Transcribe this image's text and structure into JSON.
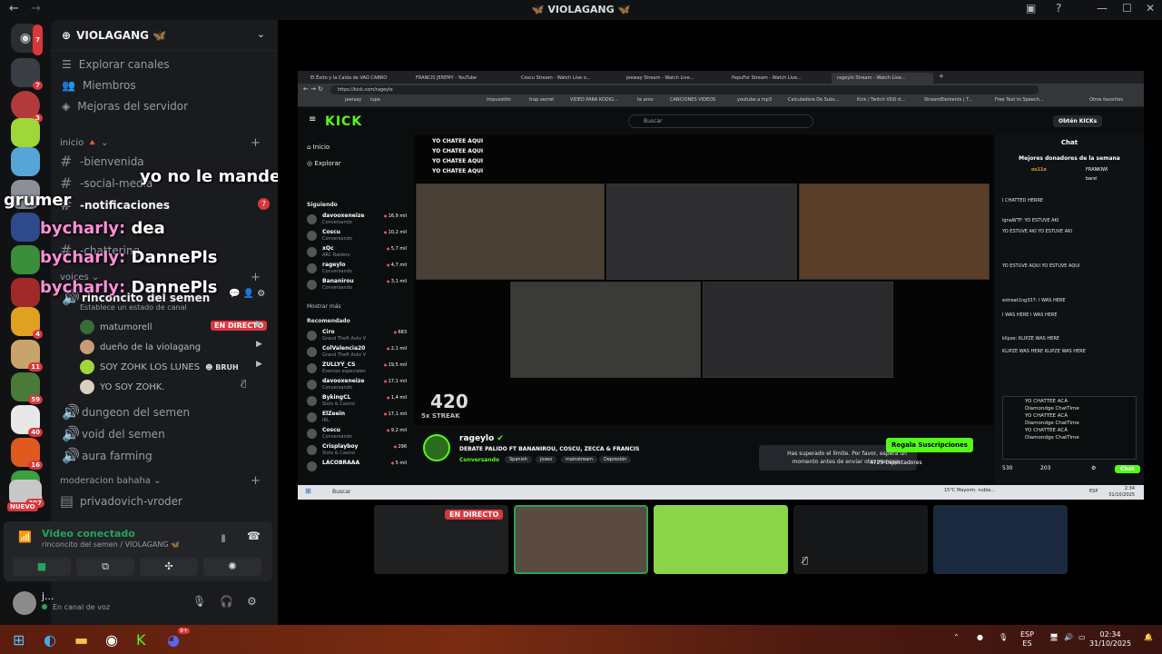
{
  "window": {
    "title": "VIOLAGANG",
    "title_emoji": "🦋"
  },
  "server_rail": {
    "badges": [
      "7",
      "7",
      "3",
      "4",
      "11",
      "59",
      "40",
      "16",
      "114",
      "397"
    ],
    "new_label": "NUEVO"
  },
  "server": {
    "name": "VIOLAGANG",
    "emoji": "🦋",
    "nav": [
      "Explorar canales",
      "Miembros",
      "Mejoras del servidor"
    ]
  },
  "categories": {
    "inicio": "inicio",
    "voices": "voices",
    "moderacion": "moderacion bahaha"
  },
  "channels": {
    "bienvenida": "-bienvenida",
    "social": "-social-media",
    "notificaciones": "-notificaciones",
    "notificaciones_badge": "7",
    "chattering": "-chattering",
    "rinconcito": "rinconcito del semen",
    "status_hint": "Establece un estado de canal",
    "dungeon": "dungeon del semen",
    "void": "void del semen",
    "aura": "aura farming",
    "privadovich": "privadovich-vroder"
  },
  "voice_users": [
    {
      "name": "matumorell",
      "live": "EN DIRECTO"
    },
    {
      "name": "dueño de la violagang"
    },
    {
      "name": "SOY ZOHK LOS LUNES",
      "tag": "BRUH"
    },
    {
      "name": "YO SOY ZOHK."
    }
  ],
  "overlay_chat": [
    {
      "text": "yo no le mande nada"
    },
    {
      "text": "grumer"
    },
    {
      "user": "bycharly:",
      "text": "dea"
    },
    {
      "user": "bycharly:",
      "text": "DannePls"
    },
    {
      "user": "bycharly:",
      "text": "DannePls"
    }
  ],
  "voice_panel": {
    "status": "Video conectado",
    "location": "rinconcito del semen / VIOLAGANG"
  },
  "user": {
    "name": "j...",
    "status": "En canal de voz"
  },
  "browser": {
    "tabs": [
      "El Éxito y la Caída de VAO CABRO",
      "FRANCIS JEREMY - YouTube",
      "Coscu Stream - Watch Live o...",
      "jeeway Stream - Watch Live...",
      "PepuFor Stream - Watch Live...",
      "rageylo Stream - Watch Live..."
    ],
    "url": "https://kick.com/rageylo",
    "bookmarks": [
      "jeersay",
      "lupe",
      "impuestito",
      "trap secret",
      "VIDEO PARA KODIG...",
      "te amo",
      "CANCIONES VIDEOS",
      "youtube a mp3",
      "Calculadora De Subs...",
      "Kick / Twitch VOD d...",
      "StreamElements | T...",
      "Free Text to Speech...",
      "Otros favoritos"
    ]
  },
  "kick": {
    "logo": "KICK",
    "search_placeholder": "Buscar",
    "get_kicks": "Obtén KICKs",
    "nav": [
      "Inicio",
      "Explorar"
    ],
    "following_label": "Siguiendo",
    "following": [
      {
        "name": "davooxeneize",
        "game": "Conversando",
        "viewers": "16,9 mil"
      },
      {
        "name": "Coscu",
        "game": "Conversando",
        "viewers": "10,2 mil"
      },
      {
        "name": "xQc",
        "game": "ARC Raiders",
        "viewers": "5,7 mil"
      },
      {
        "name": "rageylo",
        "game": "Conversando",
        "viewers": "4,7 mil"
      },
      {
        "name": "Bananirou",
        "game": "Conversando",
        "viewers": "3,1 mil"
      }
    ],
    "show_more": "Mostrar más",
    "recommended_label": "Recomendado",
    "recommended": [
      {
        "name": "Ciro",
        "game": "Grand Theft Auto V",
        "viewers": "683"
      },
      {
        "name": "ColValencia20",
        "game": "Grand Theft Auto V",
        "viewers": "2,1 mil"
      },
      {
        "name": "ZULLYY_CS",
        "game": "Eventos especiales",
        "viewers": "19,5 mil"
      },
      {
        "name": "davooxeneize",
        "game": "Conversando",
        "viewers": "17,1 mil"
      },
      {
        "name": "BykingCL",
        "game": "Slots & Casino",
        "viewers": "1,4 mil"
      },
      {
        "name": "ElZeein",
        "game": "IRL",
        "viewers": "17,1 mil"
      },
      {
        "name": "Coscu",
        "game": "Conversando",
        "viewers": "9,2 mil"
      },
      {
        "name": "Crisplayboy",
        "game": "Slots & Casino",
        "viewers": "296"
      },
      {
        "name": "LACOBRAAA",
        "game": "",
        "viewers": "5 mil"
      }
    ],
    "channel": "rageylo",
    "stream_title": "DEBATE PALIDO FT BANANIROU, COSCU, ZECCA & FRANCIS",
    "category": "Conversando",
    "tags": [
      "Spanish",
      "joseo",
      "mainstream",
      "Depresión"
    ],
    "limit_msg": "Has superado el límite. Por favor, espera un momento antes de enviar otro mensaje.",
    "subscribe": "Regala Suscripciones",
    "viewers": "4725",
    "viewers_label": "Espectadores",
    "chat_title": "Chat",
    "top_donors": "Mejores donadores de la semana",
    "donors": [
      "os11o",
      "FRANKIWI",
      "barxi"
    ],
    "chat_lines": [
      "I CHATTED HERRE",
      "lgnaWTF: YO ESTUVE AKI",
      "YO ESTUVE AKI YO ESTUVE AKI",
      "YO ESTUVE AQUI YO ESTUVE AQUI",
      "estreat1ng337: I WAS HERE",
      "I WAS HERE I WAS HERE",
      "klipze: KLIPZE WAS HERE",
      "KLIPZE WAS HERE KLIPZE WAS HERE"
    ],
    "chat_input_lines": [
      "YO CHATTEE ACÁ",
      "Diamondge ChatTime",
      "YO CHATTEE ACÁ",
      "Diamondge ChatTime",
      "YO CHATTEE ACÁ",
      "Diamondge ChatTime"
    ],
    "chat_points": "530",
    "chat_count": "203",
    "chat_button": "Chat",
    "overlay_text": "YO CHATEE AQUI",
    "streak": "5x STREAK",
    "streak_num": "420"
  },
  "inner_taskbar": {
    "search": "Buscar",
    "weather": "15°C  Mayorm. nubla...",
    "lang": "ESP",
    "time": "2:34",
    "date": "31/10/2025"
  },
  "tiles": {
    "live": "EN DIRECTO"
  },
  "taskbar": {
    "lang1": "ESP",
    "lang2": "ES",
    "time": "02:34",
    "date": "31/10/2025",
    "discord_badge": "9+"
  }
}
